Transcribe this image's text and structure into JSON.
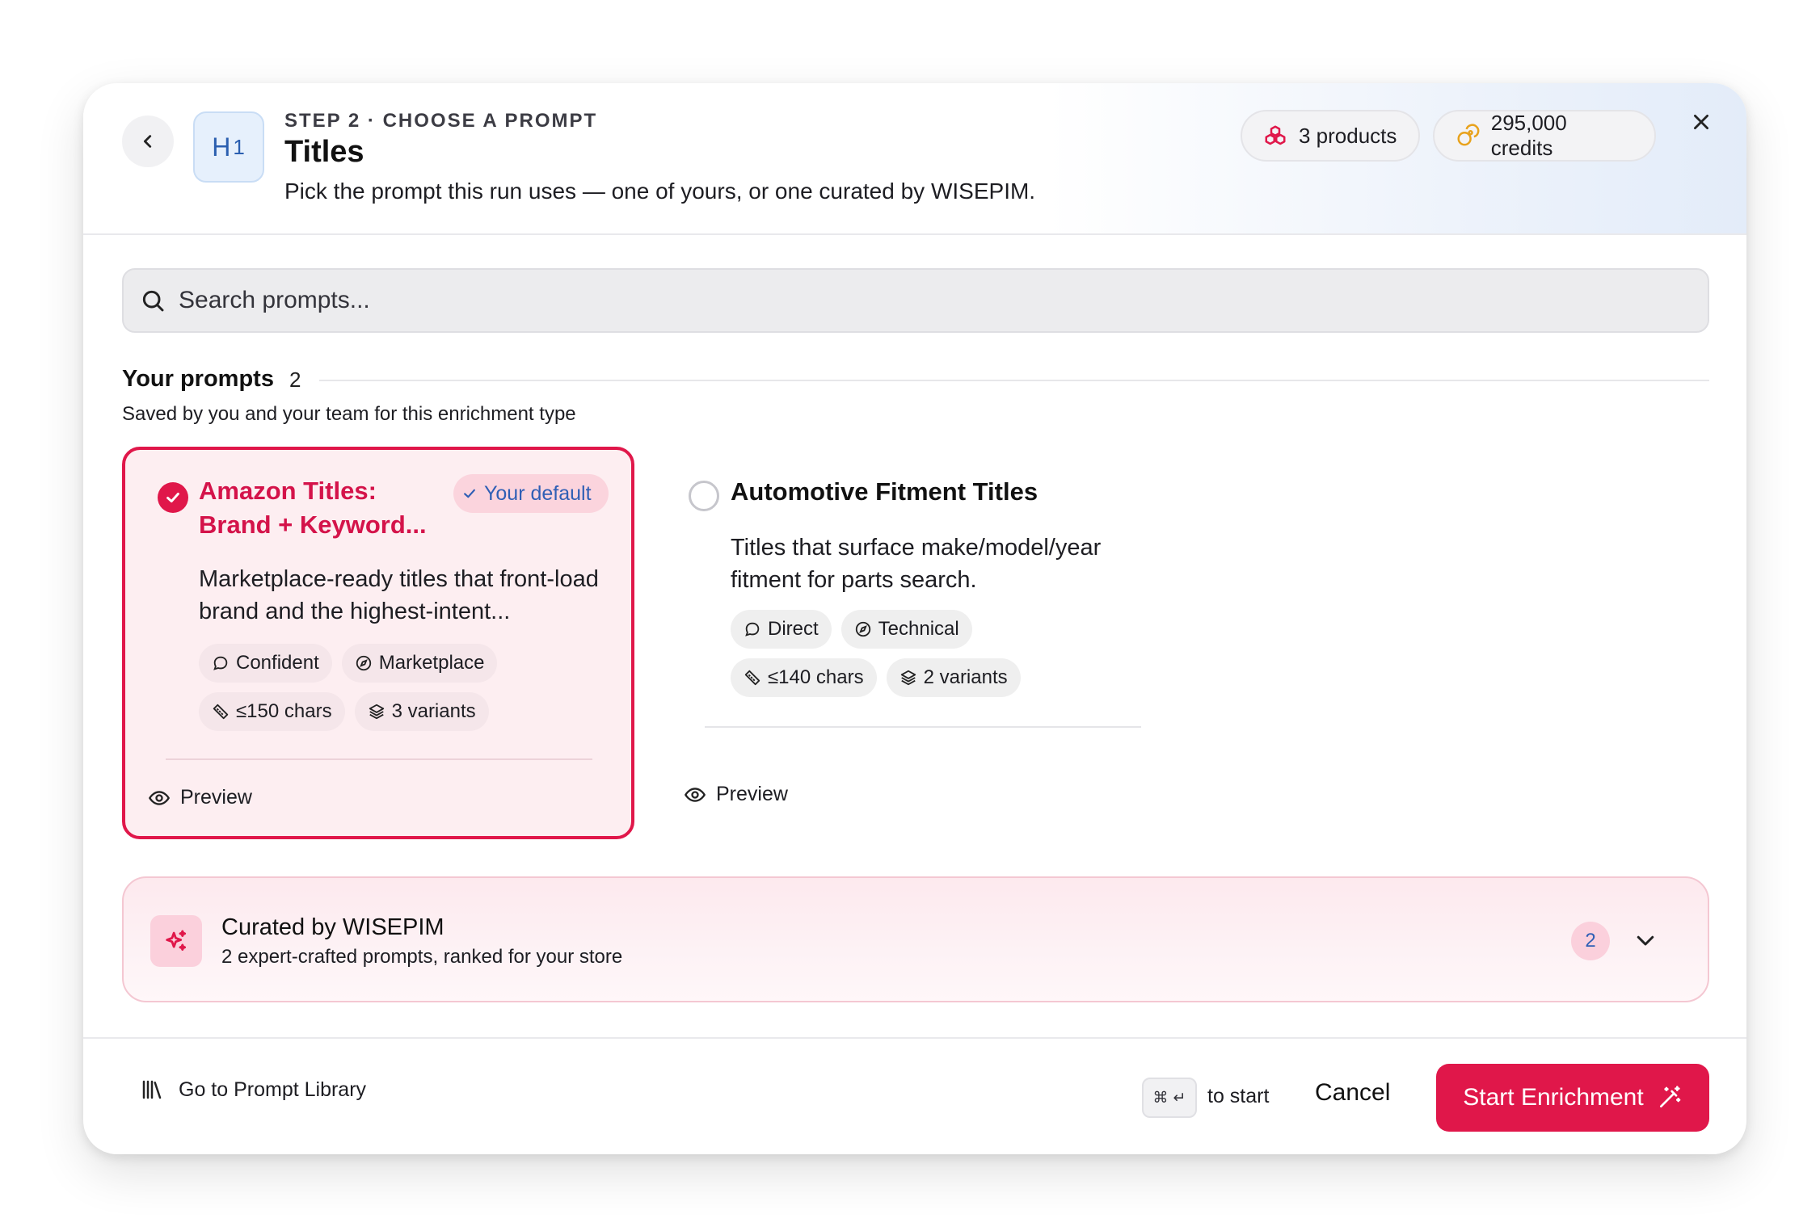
{
  "header": {
    "step_label": "STEP 2 · CHOOSE A PROMPT",
    "title": "Titles",
    "subtitle": "Pick the prompt this run uses — one of yours, or one curated by WISEPIM.",
    "type_icon_text": "H",
    "type_icon_sub": "1",
    "products_label": "3 products",
    "credits_label": "295,000 credits",
    "icons": {
      "back": "chevron-left-icon",
      "close": "close-icon",
      "products": "cubes-icon",
      "credits": "coins-icon"
    }
  },
  "search": {
    "placeholder": "Search prompts..."
  },
  "your_prompts": {
    "title": "Your prompts",
    "count": "2",
    "description": "Saved by you and your team for this enrichment type",
    "cards": [
      {
        "title": "Amazon Titles: Brand + Keyword...",
        "selected": true,
        "badge": "Your default",
        "description": "Marketplace-ready titles that front-load brand and the highest-intent...",
        "tone": "Confident",
        "style": "Marketplace",
        "length": "≤150 chars",
        "variants": "3 variants",
        "preview_label": "Preview"
      },
      {
        "title": "Automotive Fitment Titles",
        "selected": false,
        "description": "Titles that surface make/model/year fitment for parts search.",
        "tone": "Direct",
        "style": "Technical",
        "length": "≤140 chars",
        "variants": "2 variants",
        "preview_label": "Preview"
      }
    ]
  },
  "curated": {
    "title": "Curated by WISEPIM",
    "subtitle": "2 expert-crafted prompts, ranked for your store",
    "count": "2"
  },
  "footer": {
    "library_link": "Go to Prompt Library",
    "shortcut_keys": "⌘ ↵",
    "shortcut_hint": "to start",
    "cancel_label": "Cancel",
    "start_label": "Start Enrichment"
  },
  "colors": {
    "accent": "#e0174a",
    "accent_soft": "#fdeef1",
    "link_blue": "#2f5fb5",
    "credits_gold": "#e8a21c"
  }
}
